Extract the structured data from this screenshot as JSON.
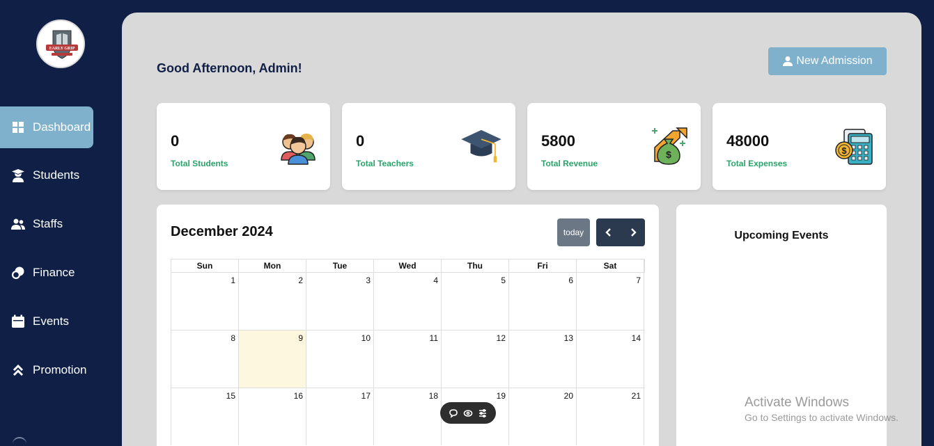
{
  "sidebar": {
    "logo_alt": "EARLY GRIP",
    "items": [
      {
        "label": "Dashboard",
        "icon": "grid-icon"
      },
      {
        "label": "Students",
        "icon": "graduate-icon"
      },
      {
        "label": "Staffs",
        "icon": "users-icon"
      },
      {
        "label": "Finance",
        "icon": "coins-icon"
      },
      {
        "label": "Events",
        "icon": "calendar-icon"
      },
      {
        "label": "Promotion",
        "icon": "chevrons-up-icon"
      }
    ]
  },
  "header": {
    "greeting": "Good Afternoon, Admin!",
    "new_admission_label": "New Admission"
  },
  "stats": [
    {
      "value": "0",
      "label": "Total Students",
      "icon": "students-group-icon"
    },
    {
      "value": "0",
      "label": "Total Teachers",
      "icon": "graduation-cap-icon"
    },
    {
      "value": "5800",
      "label": "Total Revenue",
      "icon": "money-bag-icon"
    },
    {
      "value": "48000",
      "label": "Total Expenses",
      "icon": "calculator-coin-icon"
    }
  ],
  "calendar": {
    "title": "December 2024",
    "today_label": "today",
    "weekdays": [
      "Sun",
      "Mon",
      "Tue",
      "Wed",
      "Thu",
      "Fri",
      "Sat"
    ],
    "weeks": [
      [
        "1",
        "2",
        "3",
        "4",
        "5",
        "6",
        "7"
      ],
      [
        "8",
        "9",
        "10",
        "11",
        "12",
        "13",
        "14"
      ],
      [
        "15",
        "16",
        "17",
        "18",
        "19",
        "20",
        "21"
      ]
    ],
    "highlighted_day": "9"
  },
  "events": {
    "title": "Upcoming Events"
  },
  "watermark": {
    "line1": "Activate Windows",
    "line2": "Go to Settings to activate Windows."
  },
  "colors": {
    "sidebar_bg": "#0f1f45",
    "accent": "#7fb1cc",
    "stat_label": "#2aa36a",
    "today_bg": "#fdf7df"
  }
}
